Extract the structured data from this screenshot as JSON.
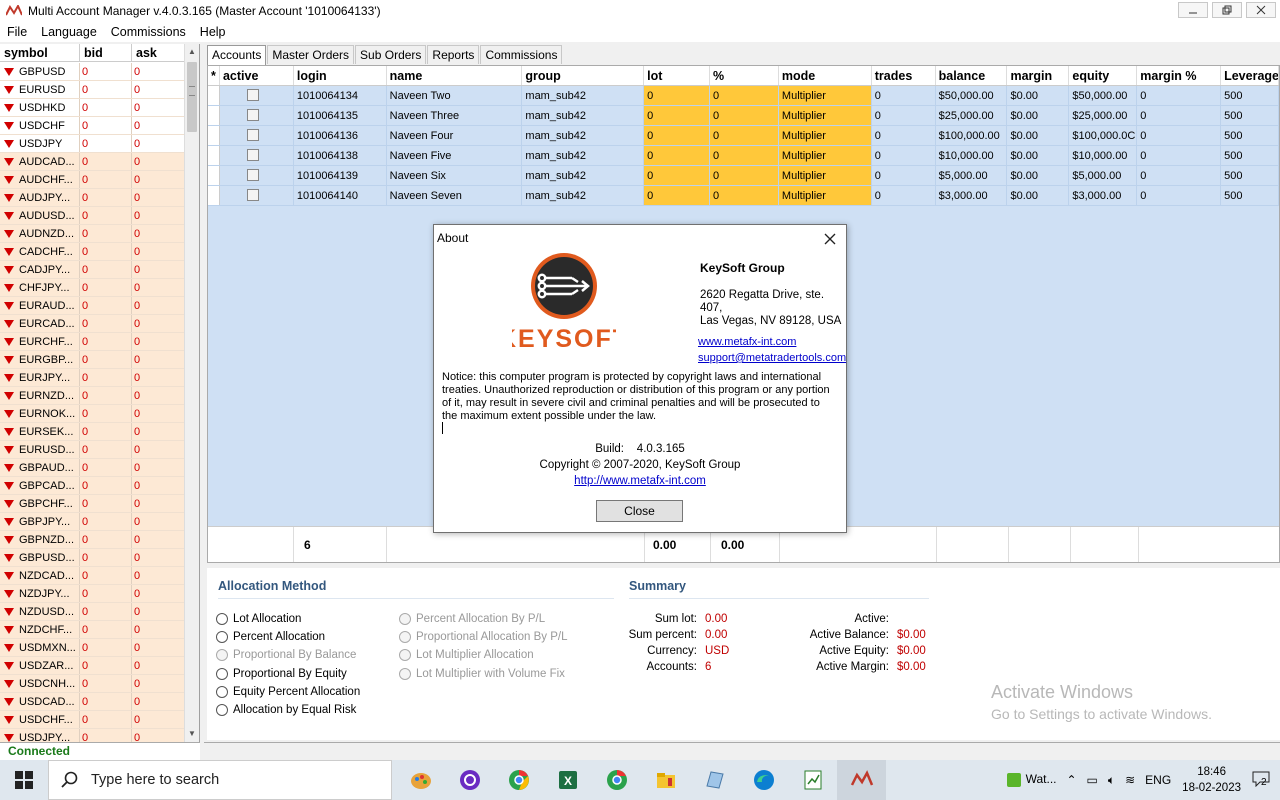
{
  "window": {
    "title": "Multi Account Manager v.4.0.3.165 (Master Account '1010064133')"
  },
  "menu": [
    "File",
    "Language",
    "Commissions",
    "Help"
  ],
  "symbol_panel": {
    "headers": [
      "symbol",
      "bid",
      "ask"
    ],
    "rows": [
      {
        "symbol": "GBPUSD",
        "bid": "0",
        "ask": "0",
        "hl": false
      },
      {
        "symbol": "EURUSD",
        "bid": "0",
        "ask": "0",
        "hl": false
      },
      {
        "symbol": "USDHKD",
        "bid": "0",
        "ask": "0",
        "hl": false
      },
      {
        "symbol": "USDCHF",
        "bid": "0",
        "ask": "0",
        "hl": false
      },
      {
        "symbol": "USDJPY",
        "bid": "0",
        "ask": "0",
        "hl": false
      },
      {
        "symbol": "AUDCAD...",
        "bid": "0",
        "ask": "0",
        "hl": true
      },
      {
        "symbol": "AUDCHF...",
        "bid": "0",
        "ask": "0",
        "hl": true
      },
      {
        "symbol": "AUDJPY...",
        "bid": "0",
        "ask": "0",
        "hl": true
      },
      {
        "symbol": "AUDUSD...",
        "bid": "0",
        "ask": "0",
        "hl": true
      },
      {
        "symbol": "AUDNZD...",
        "bid": "0",
        "ask": "0",
        "hl": true
      },
      {
        "symbol": "CADCHF...",
        "bid": "0",
        "ask": "0",
        "hl": true
      },
      {
        "symbol": "CADJPY...",
        "bid": "0",
        "ask": "0",
        "hl": true
      },
      {
        "symbol": "CHFJPY...",
        "bid": "0",
        "ask": "0",
        "hl": true
      },
      {
        "symbol": "EURAUD...",
        "bid": "0",
        "ask": "0",
        "hl": true
      },
      {
        "symbol": "EURCAD...",
        "bid": "0",
        "ask": "0",
        "hl": true
      },
      {
        "symbol": "EURCHF...",
        "bid": "0",
        "ask": "0",
        "hl": true
      },
      {
        "symbol": "EURGBP...",
        "bid": "0",
        "ask": "0",
        "hl": true
      },
      {
        "symbol": "EURJPY...",
        "bid": "0",
        "ask": "0",
        "hl": true
      },
      {
        "symbol": "EURNZD...",
        "bid": "0",
        "ask": "0",
        "hl": true
      },
      {
        "symbol": "EURNOK...",
        "bid": "0",
        "ask": "0",
        "hl": true
      },
      {
        "symbol": "EURSEK...",
        "bid": "0",
        "ask": "0",
        "hl": true
      },
      {
        "symbol": "EURUSD...",
        "bid": "0",
        "ask": "0",
        "hl": true
      },
      {
        "symbol": "GBPAUD...",
        "bid": "0",
        "ask": "0",
        "hl": true
      },
      {
        "symbol": "GBPCAD...",
        "bid": "0",
        "ask": "0",
        "hl": true
      },
      {
        "symbol": "GBPCHF...",
        "bid": "0",
        "ask": "0",
        "hl": true
      },
      {
        "symbol": "GBPJPY...",
        "bid": "0",
        "ask": "0",
        "hl": true
      },
      {
        "symbol": "GBPNZD...",
        "bid": "0",
        "ask": "0",
        "hl": true
      },
      {
        "symbol": "GBPUSD...",
        "bid": "0",
        "ask": "0",
        "hl": true
      },
      {
        "symbol": "NZDCAD...",
        "bid": "0",
        "ask": "0",
        "hl": true
      },
      {
        "symbol": "NZDJPY...",
        "bid": "0",
        "ask": "0",
        "hl": true
      },
      {
        "symbol": "NZDUSD...",
        "bid": "0",
        "ask": "0",
        "hl": true
      },
      {
        "symbol": "NZDCHF...",
        "bid": "0",
        "ask": "0",
        "hl": true
      },
      {
        "symbol": "USDMXN...",
        "bid": "0",
        "ask": "0",
        "hl": true
      },
      {
        "symbol": "USDZAR...",
        "bid": "0",
        "ask": "0",
        "hl": true
      },
      {
        "symbol": "USDCNH...",
        "bid": "0",
        "ask": "0",
        "hl": true
      },
      {
        "symbol": "USDCAD...",
        "bid": "0",
        "ask": "0",
        "hl": true
      },
      {
        "symbol": "USDCHF...",
        "bid": "0",
        "ask": "0",
        "hl": true
      },
      {
        "symbol": "USDJPY...",
        "bid": "0",
        "ask": "0",
        "hl": true
      }
    ]
  },
  "status": {
    "connection": "Connected"
  },
  "tabs": [
    "Accounts",
    "Master Orders",
    "Sub Orders",
    "Reports",
    "Commissions"
  ],
  "accounts": {
    "headers": [
      "*",
      "active",
      "login",
      "name",
      "group",
      "lot",
      "%",
      "mode",
      "trades",
      "balance",
      "margin",
      "equity",
      "margin %",
      "Leverage"
    ],
    "rows": [
      {
        "login": "1010064134",
        "name": "Naveen Two",
        "group": "mam_sub42",
        "lot": "0",
        "pct": "0",
        "mode": "Multiplier",
        "trades": "0",
        "balance": "$50,000.00",
        "margin": "$0.00",
        "equity": "$50,000.00",
        "margin_pct": "0",
        "leverage": "500"
      },
      {
        "login": "1010064135",
        "name": "Naveen Three",
        "group": "mam_sub42",
        "lot": "0",
        "pct": "0",
        "mode": "Multiplier",
        "trades": "0",
        "balance": "$25,000.00",
        "margin": "$0.00",
        "equity": "$25,000.00",
        "margin_pct": "0",
        "leverage": "500"
      },
      {
        "login": "1010064136",
        "name": "Naveen Four",
        "group": "mam_sub42",
        "lot": "0",
        "pct": "0",
        "mode": "Multiplier",
        "trades": "0",
        "balance": "$100,000.00",
        "margin": "$0.00",
        "equity": "$100,000.0C",
        "margin_pct": "0",
        "leverage": "500"
      },
      {
        "login": "1010064138",
        "name": "Naveen Five",
        "group": "mam_sub42",
        "lot": "0",
        "pct": "0",
        "mode": "Multiplier",
        "trades": "0",
        "balance": "$10,000.00",
        "margin": "$0.00",
        "equity": "$10,000.00",
        "margin_pct": "0",
        "leverage": "500"
      },
      {
        "login": "1010064139",
        "name": "Naveen Six",
        "group": "mam_sub42",
        "lot": "0",
        "pct": "0",
        "mode": "Multiplier",
        "trades": "0",
        "balance": "$5,000.00",
        "margin": "$0.00",
        "equity": "$5,000.00",
        "margin_pct": "0",
        "leverage": "500"
      },
      {
        "login": "1010064140",
        "name": "Naveen Seven",
        "group": "mam_sub42",
        "lot": "0",
        "pct": "0",
        "mode": "Multiplier",
        "trades": "0",
        "balance": "$3,000.00",
        "margin": "$0.00",
        "equity": "$3,000.00",
        "margin_pct": "0",
        "leverage": "500"
      }
    ],
    "totals": {
      "count": "6",
      "lot": "0.00",
      "pct": "0.00"
    }
  },
  "allocation": {
    "title": "Allocation Method",
    "left": [
      {
        "label": "Lot Allocation",
        "disabled": false
      },
      {
        "label": "Percent Allocation",
        "disabled": false
      },
      {
        "label": "Proportional By Balance",
        "disabled": true
      },
      {
        "label": "Proportional By Equity",
        "disabled": false
      },
      {
        "label": "Equity Percent Allocation",
        "disabled": false
      },
      {
        "label": "Allocation by Equal Risk",
        "disabled": false
      }
    ],
    "right": [
      {
        "label": "Percent Allocation By P/L",
        "disabled": true
      },
      {
        "label": "Proportional Allocation By P/L",
        "disabled": true
      },
      {
        "label": "Lot Multiplier Allocation",
        "disabled": true
      },
      {
        "label": "Lot Multiplier with Volume Fix",
        "disabled": true
      }
    ]
  },
  "summary": {
    "title": "Summary",
    "left": [
      {
        "k": "Sum lot:",
        "v": "0.00"
      },
      {
        "k": "Sum percent:",
        "v": "0.00"
      },
      {
        "k": "Currency:",
        "v": "USD"
      },
      {
        "k": "Accounts:",
        "v": "6"
      }
    ],
    "right": [
      {
        "k": "Active:",
        "v": ""
      },
      {
        "k": "Active Balance:",
        "v": "$0.00"
      },
      {
        "k": "Active Equity:",
        "v": "$0.00"
      },
      {
        "k": "Active Margin:",
        "v": "$0.00"
      }
    ]
  },
  "watermark": {
    "line1": "Activate Windows",
    "line2": "Go to Settings to activate Windows."
  },
  "about": {
    "title": "About",
    "logo_text": "KEYSOFT",
    "company": "KeySoft Group",
    "address1": "2620 Regatta Drive, ste. 407,",
    "address2": "Las Vegas, NV 89128, USA",
    "link1": "www.metafx-int.com",
    "link2": "support@metatradertools.com",
    "notice": "Notice: this computer program is protected by copyright laws and international treaties. Unauthorized reproduction or distribution of this program or any portion of it, may result in severe civil and criminal penalties and will be prosecuted to the maximum extent possible under the law.",
    "build_label": "Build:",
    "build": "4.0.3.165",
    "copyright": "Copyright © 2007-2020, KeySoft Group",
    "site": "http://www.metafx-int.com",
    "close": "Close",
    "logo_color": "#e05a1e"
  },
  "taskbar": {
    "search_placeholder": "Type here to search",
    "weather": "Wat...",
    "lang": "ENG",
    "time": "18:46",
    "date": "18-02-2023",
    "notifications": "2"
  }
}
